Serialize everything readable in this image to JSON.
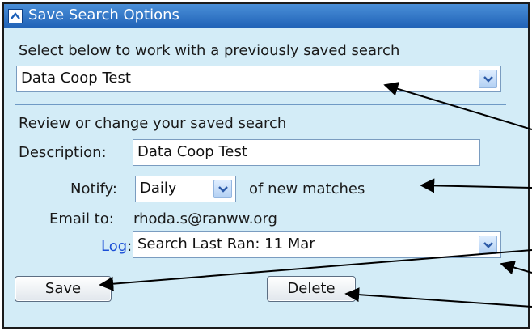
{
  "panel": {
    "title": "Save Search Options",
    "select_label": "Select below to work with a previously saved search",
    "saved_search_value": "Data Coop Test",
    "review_label": "Review or change your saved search",
    "description_label": "Description:",
    "description_value": "Data Coop Test",
    "notify_label": "Notify:",
    "notify_value": "Daily",
    "notify_suffix": "of new matches",
    "email_label": "Email to:",
    "email_value": "rhoda.s@ranww.org",
    "log_link": "Log",
    "log_colon": ":",
    "log_value": "Search Last Ran: 11 Mar",
    "save_label": "Save",
    "delete_label": "Delete"
  },
  "colors": {
    "titlebar": "#2a6fc4",
    "panel_bg": "#d3ecf7",
    "link": "#1b4fd6"
  }
}
